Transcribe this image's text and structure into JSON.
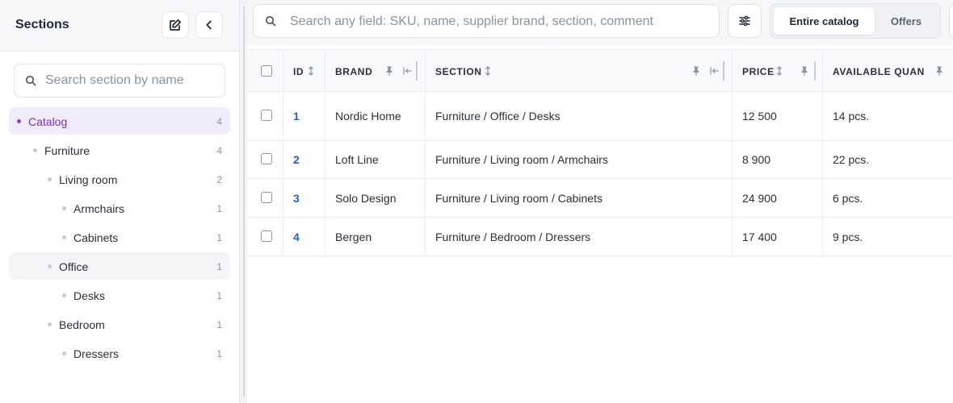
{
  "sidebar": {
    "title": "Sections",
    "search_placeholder": "Search section by name",
    "items": [
      {
        "label": "Catalog",
        "count": "4"
      },
      {
        "label": "Furniture",
        "count": "4"
      },
      {
        "label": "Living room",
        "count": "2"
      },
      {
        "label": "Armchairs",
        "count": "1"
      },
      {
        "label": "Cabinets",
        "count": "1"
      },
      {
        "label": "Office",
        "count": "1"
      },
      {
        "label": "Desks",
        "count": "1"
      },
      {
        "label": "Bedroom",
        "count": "1"
      },
      {
        "label": "Dressers",
        "count": "1"
      }
    ]
  },
  "toolbar": {
    "search_placeholder": "Search any field: SKU, name, supplier brand, section, comment",
    "scope_entire": "Entire catalog",
    "scope_offers": "Offers"
  },
  "table": {
    "columns": {
      "id": "ID",
      "brand": "BRAND",
      "section": "SECTION",
      "price": "PRICE",
      "quantity": "AVAILABLE QUANT"
    },
    "rows": [
      {
        "id": "1",
        "brand": "Nordic Home",
        "section": "Furniture / Office / Desks",
        "price": "12 500",
        "quantity": "14 pcs."
      },
      {
        "id": "2",
        "brand": "Loft Line",
        "section": "Furniture / Living room / Armchairs",
        "price": "8 900",
        "quantity": "22 pcs."
      },
      {
        "id": "3",
        "brand": "Solo Design",
        "section": "Furniture / Living room / Cabinets",
        "price": "24 900",
        "quantity": "6 pcs."
      },
      {
        "id": "4",
        "brand": "Bergen",
        "section": "Furniture / Bedroom / Dressers",
        "price": "17 400",
        "quantity": "9 pcs."
      }
    ]
  },
  "colors": {
    "accent": "#8b3fd6",
    "active_bg": "#f1ecfb",
    "link": "#2f5db8"
  },
  "icons": [
    "edit-icon",
    "chevron-left-icon",
    "search-icon",
    "sliders-icon",
    "sort-icon",
    "pin-icon",
    "pin-left-icon"
  ]
}
